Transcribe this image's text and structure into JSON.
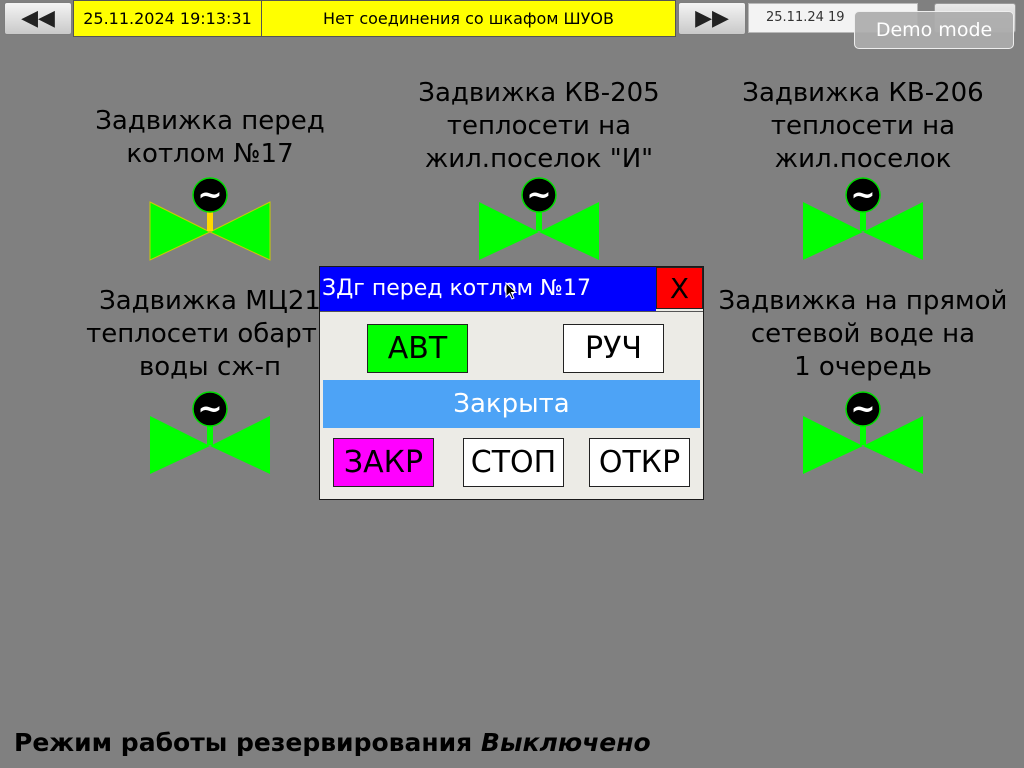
{
  "topbar": {
    "back_icon": "◀◀",
    "datetime": "25.11.2024 19:13:31",
    "message": "Нет соединения со шкафом ШУОВ",
    "forward_icon": "▶▶",
    "date_short": "25.11.24 19",
    "demo_label": "Demo mode"
  },
  "valves": [
    {
      "label_lines": [
        "Задвижка перед",
        "котлом №17"
      ],
      "color": "#00ff00",
      "stem_color": "#ffd700",
      "symbol": "~"
    },
    {
      "label_lines": [
        "Задвижка КВ-205",
        "теплосети на",
        "жил.поселок \"И\""
      ],
      "color": "#00ff00",
      "stem_color": "#00ff00",
      "symbol": "~"
    },
    {
      "label_lines": [
        "Задвижка КВ-206",
        "теплосети на",
        "жил.поселок"
      ],
      "color": "#00ff00",
      "stem_color": "#00ff00",
      "symbol": "~"
    },
    {
      "label_lines": [
        "Задвижка МЦ21",
        "теплосети обартн",
        "воды сж-п"
      ],
      "color": "#00ff00",
      "stem_color": "#00ff00",
      "symbol": "~"
    },
    {
      "label_lines": [
        "Задвижка на прямой",
        "сетевой воде на",
        "1 очередь"
      ],
      "color": "#00ff00",
      "stem_color": "#00ff00",
      "symbol": "~"
    }
  ],
  "dialog": {
    "title": "ЗДг перед котлом №17",
    "close_label": "X",
    "mode_auto_label": "АВТ",
    "mode_manual_label": "РУЧ",
    "status_text": "Закрыта",
    "close_cmd_label": "ЗАКР",
    "stop_cmd_label": "СТОП",
    "open_cmd_label": "ОТКР",
    "colors": {
      "title_bg": "#0000ff",
      "close_bg": "#ff0000",
      "auto_active": "#00ff00",
      "close_cmd": "#ff00ff",
      "status_bg": "#4da3f6"
    }
  },
  "footer": {
    "label": "Режим работы резервирования",
    "value": "Выключено"
  }
}
